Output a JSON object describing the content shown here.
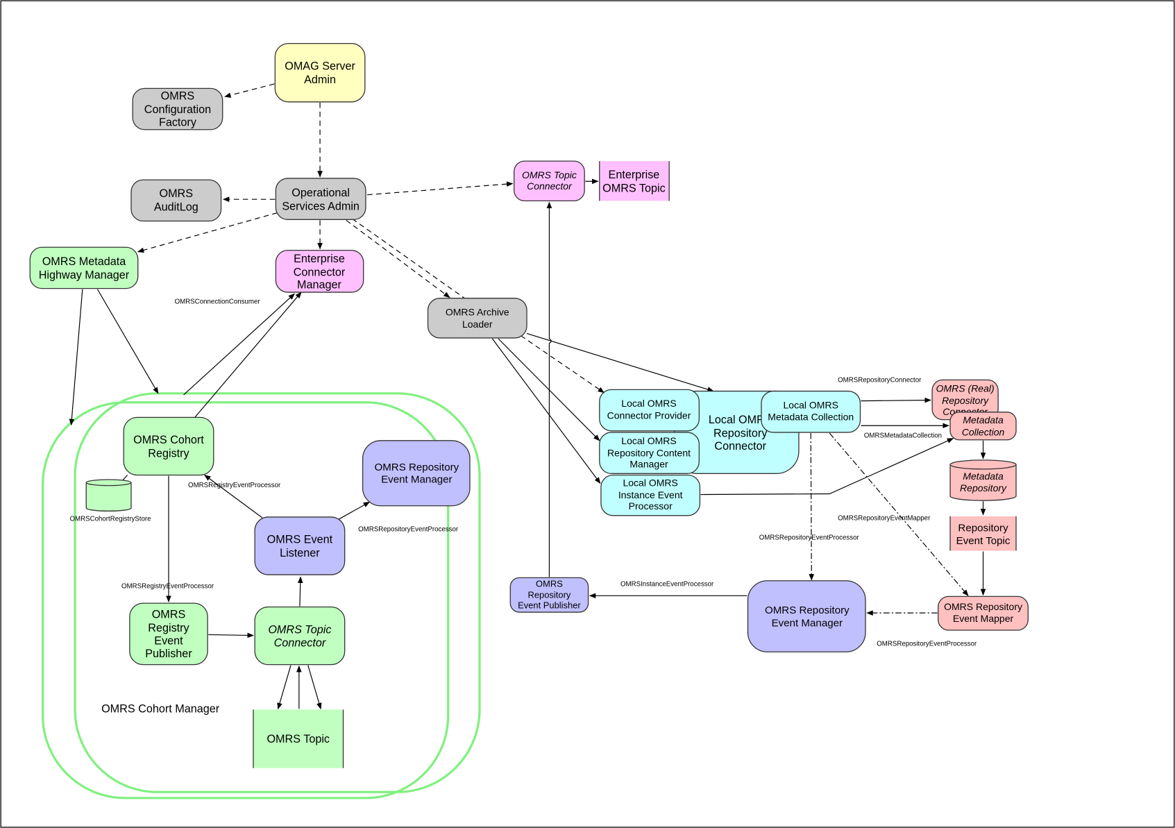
{
  "colors": {
    "yellow": "#ffffc0",
    "gray": "#cccccc",
    "green": "#c0ffc0",
    "pink": "#ffc0ff",
    "cyan": "#c0ffff",
    "salmon": "#ffc0c0",
    "purple": "#c0c0ff",
    "cohort_outline": "#80f080"
  },
  "nodes": {
    "omag_server_admin": [
      "OMAG Server",
      "Admin"
    ],
    "config_factory": [
      "OMRS",
      "Configuration",
      "Factory"
    ],
    "audit_log": [
      "OMRS",
      "AuditLog"
    ],
    "operational_services_admin": [
      "Operational",
      "Services Admin"
    ],
    "metadata_highway_manager": [
      "OMRS Metadata",
      "Highway Manager"
    ],
    "enterprise_connector_manager": [
      "Enterprise",
      "Connector",
      "Manager"
    ],
    "top_topic_connector": [
      "OMRS Topic",
      "Connector"
    ],
    "enterprise_topic": [
      "Enterprise",
      "OMRS Topic"
    ],
    "archive_loader": [
      "OMRS Archive",
      "Loader"
    ],
    "local_repository_connector": [
      "Local OMRS",
      "Repository",
      "Connector"
    ],
    "local_connector_provider": [
      "Local OMRS",
      "Connector Provider"
    ],
    "local_content_manager": [
      "Local OMRS",
      "Repository Content",
      "Manager"
    ],
    "local_instance_event_processor": [
      "Local OMRS",
      "Instance Event",
      "Processor"
    ],
    "local_metadata_collection": [
      "Local OMRS",
      "Metadata Collection"
    ],
    "real_repository_connector": [
      "OMRS (Real)",
      "Repository",
      "Connector"
    ],
    "metadata_collection": [
      "Metadata",
      "Collection"
    ],
    "metadata_repository": [
      "Metadata",
      "Repository"
    ],
    "repository_event_topic": [
      "Repository",
      "Event Topic"
    ],
    "repository_event_mapper": [
      "OMRS Repository",
      "Event Mapper"
    ],
    "repository_event_manager_right": [
      "OMRS Repository",
      "Event Manager"
    ],
    "repository_event_publisher": [
      "OMRS",
      "Repository",
      "Event Publisher"
    ],
    "cohort_registry": [
      "OMRS Cohort",
      "Registry"
    ],
    "repository_event_manager_left": [
      "OMRS Repository",
      "Event Manager"
    ],
    "event_listener": [
      "OMRS Event",
      "Listener"
    ],
    "registry_event_publisher": [
      "OMRS",
      "Registry",
      "Event",
      "Publisher"
    ],
    "cohort_topic_connector": [
      "OMRS Topic",
      "Connector"
    ],
    "omrs_topic": [
      "OMRS Topic"
    ]
  },
  "cohort_manager_label": "OMRS Cohort Manager",
  "edge_labels": {
    "connection_consumer": "OMRSConnectionConsumer",
    "registry_event_processor_1": "OMRSRegistryEventProcessor",
    "cohort_registry_store": "OMRSCohortRegistryStore",
    "repository_event_processor_1": "OMRSRepositoryEventProcessor",
    "registry_event_processor_2": "OMRSRegistryEventProcessor",
    "repository_connector": "OMRSRepositoryConnector",
    "metadata_collection": "OMRSMetadataCollection",
    "repository_event_mapper": "OMRSRepositoryEventMapper",
    "repository_event_processor_2": "OMRSRepositoryEventProcessor",
    "instance_event_processor": "OMRSInstanceEventProcessor",
    "repository_event_processor_3": "OMRSRepositoryEventProcessor"
  }
}
